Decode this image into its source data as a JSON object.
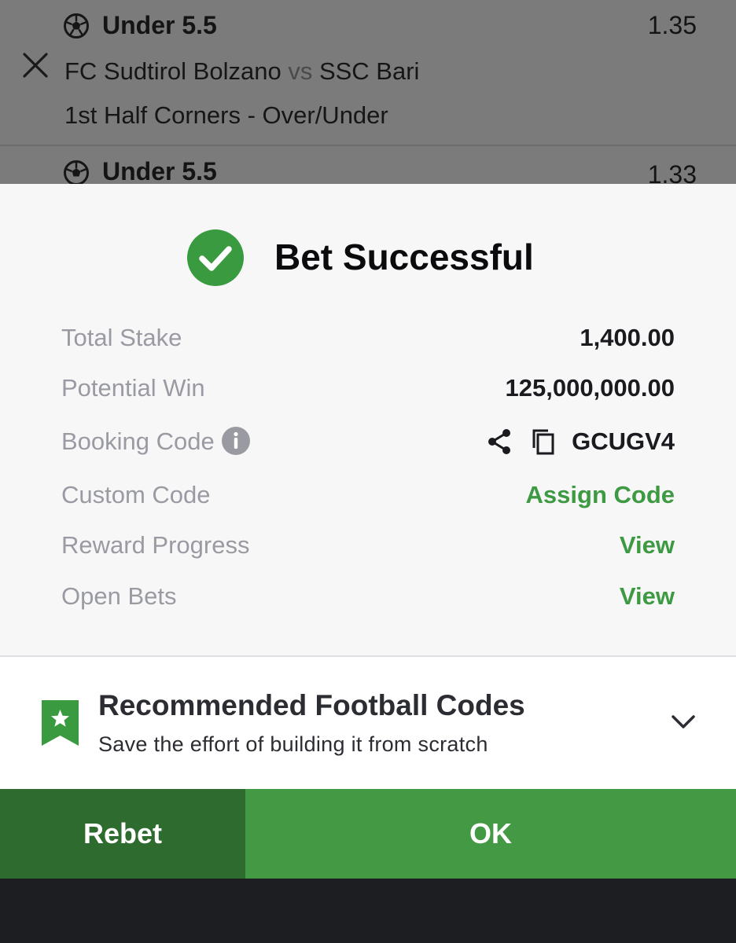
{
  "betslip": {
    "selections": [
      {
        "pick": "Under 5.5",
        "odds": "1.35",
        "home": "FC Sudtirol Bolzano",
        "vs": "vs",
        "away": "SSC Bari",
        "market": "1st Half Corners - Over/Under",
        "icon": "soccer-ball-icon"
      },
      {
        "pick": "Under 5.5",
        "odds": "1.33",
        "icon": "soccer-ball-icon"
      }
    ],
    "close_icon": "close-icon"
  },
  "result": {
    "title": "Bet Successful",
    "icon": "check-circle-icon",
    "accent_color": "#3a9a3f",
    "rows": {
      "total_stake": {
        "label": "Total Stake",
        "value": "1,400.00"
      },
      "potential_win": {
        "label": "Potential Win",
        "value": "125,000,000.00"
      },
      "booking_code": {
        "label": "Booking Code",
        "value": "GCUGV4"
      },
      "custom_code": {
        "label": "Custom Code",
        "action": "Assign Code"
      },
      "reward_progress": {
        "label": "Reward Progress",
        "action": "View"
      },
      "open_bets": {
        "label": "Open Bets",
        "action": "View"
      }
    }
  },
  "recommended": {
    "title": "Recommended Football Codes",
    "subtitle": "Save the effort of building it from scratch",
    "icon": "bookmark-star-icon"
  },
  "actions": {
    "rebet_label": "Rebet",
    "ok_label": "OK",
    "rebet_color": "#2e6b2f",
    "ok_color": "#449a44"
  }
}
